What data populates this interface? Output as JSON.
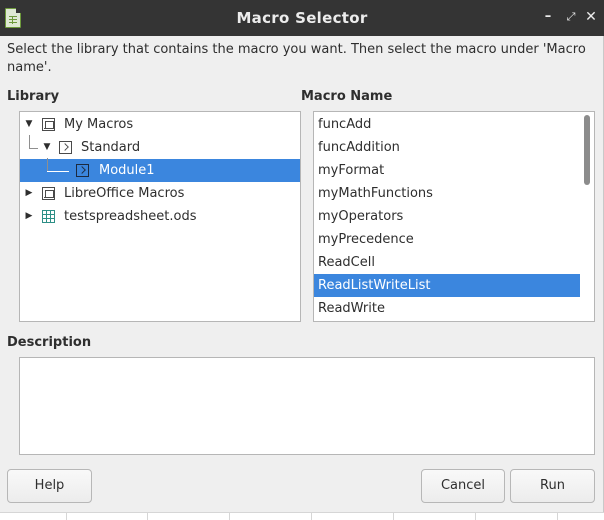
{
  "window": {
    "title": "Macro Selector",
    "icon": "libreoffice-calc-icon",
    "controls": {
      "minimize": "minimize-icon",
      "maximize": "maximize-icon",
      "close": "close-icon"
    }
  },
  "instruction": "Select the library that contains the macro you want. Then select the macro under 'Macro name'.",
  "library": {
    "label": "Library",
    "items": [
      {
        "label": "My Macros",
        "icon": "document-icon",
        "expanded": true
      },
      {
        "label": "Standard",
        "icon": "macro-library-icon",
        "expanded": true
      },
      {
        "label": "Module1",
        "icon": "module-icon",
        "selected": true
      },
      {
        "label": "LibreOffice Macros",
        "icon": "document-icon",
        "expanded": false
      },
      {
        "label": "testspreadsheet.ods",
        "icon": "spreadsheet-icon",
        "expanded": false
      }
    ]
  },
  "macros": {
    "label": "Macro Name",
    "items": [
      "funcAdd",
      "funcAddition",
      "myFormat",
      "myMathFunctions",
      "myOperators",
      "myPrecedence",
      "ReadCell",
      "ReadListWriteList",
      "ReadWrite"
    ],
    "selected": "ReadListWriteList"
  },
  "description": {
    "label": "Description",
    "value": ""
  },
  "buttons": {
    "help": "Help",
    "cancel": "Cancel",
    "run": "Run"
  },
  "colors": {
    "titlebar": "#343434",
    "selection": "#3b86de",
    "dialog": "#efefef",
    "spreadsheet_icon": "#2d8f86"
  }
}
